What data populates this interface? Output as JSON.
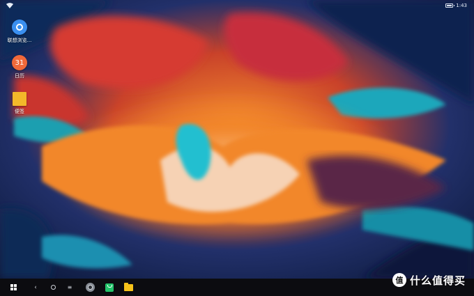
{
  "statusbar": {
    "time": "1:43",
    "battery_level": 0.9,
    "wifi_icon": "wifi-icon",
    "battery_icon": "battery-icon"
  },
  "desktop": {
    "icons": [
      {
        "label": "联想浏览...",
        "icon": "browser-icon",
        "color": "#3a8ff0"
      },
      {
        "label": "日历",
        "icon": "calendar-icon",
        "badge": "31",
        "color": "#f0693a"
      },
      {
        "label": "便签",
        "icon": "note-icon",
        "color": "#f3b82a"
      }
    ]
  },
  "taskbar": {
    "items": [
      {
        "icon": "start-icon"
      },
      {
        "icon": "back-icon"
      },
      {
        "icon": "home-icon"
      },
      {
        "icon": "recents-icon"
      },
      {
        "icon": "camera-app-icon"
      },
      {
        "icon": "app-store-icon"
      },
      {
        "icon": "files-folder-icon"
      }
    ]
  },
  "watermark": {
    "logo": "值",
    "text": "什么值得买"
  },
  "colors": {
    "taskbar_bg": "#0c0c10",
    "wallpaper_deep_blue": "#0b1f44",
    "wallpaper_orange": "#f07a22",
    "wallpaper_red": "#d8372c",
    "wallpaper_teal": "#1fb3c4"
  }
}
